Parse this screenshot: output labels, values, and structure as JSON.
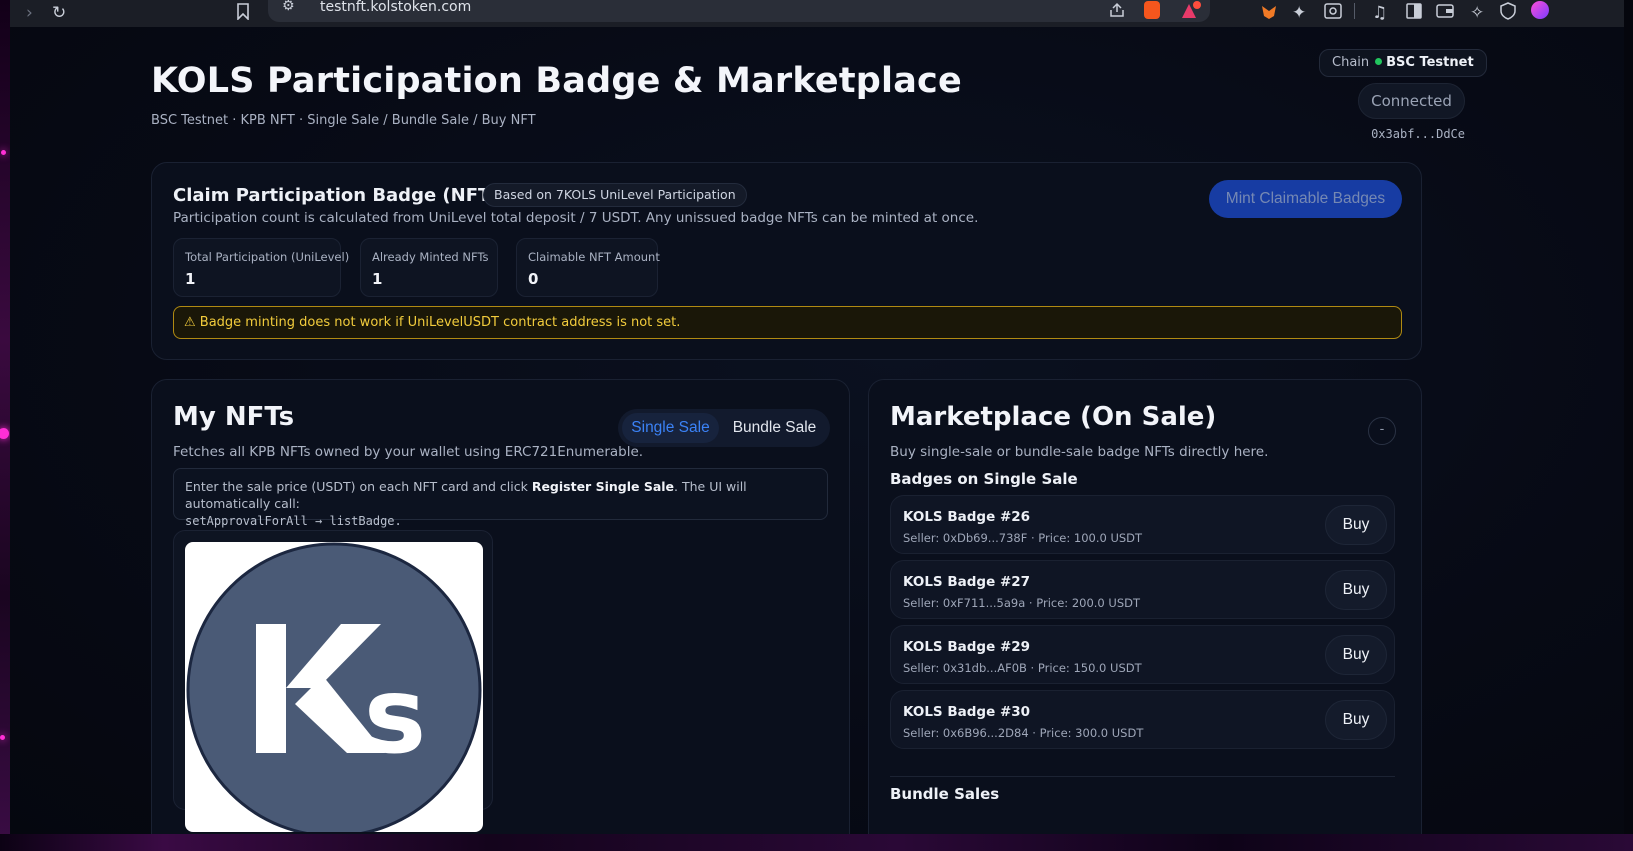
{
  "browser": {
    "url": "testnft.kolstoken.com"
  },
  "header": {
    "title": "KOLS Participation Badge & Marketplace",
    "subtitle": "BSC Testnet · KPB NFT · Single Sale / Bundle Sale / Buy NFT",
    "chain_label": "Chain",
    "chain_value": "BSC Testnet",
    "connected_label": "Connected",
    "wallet_address": "0x3abf...DdCe"
  },
  "claim": {
    "title": "Claim Participation Badge (NFT Mint)",
    "tag": "Based on 7KOLS UniLevel Participation",
    "description": "Participation count is calculated from UniLevel total deposit / 7 USDT. Any unissued badge NFTs can be minted at once.",
    "mint_button": "Mint Claimable Badges",
    "stats": [
      {
        "label": "Total Participation (UniLevel)",
        "value": "1"
      },
      {
        "label": "Already Minted NFTs",
        "value": "1"
      },
      {
        "label": "Claimable NFT Amount",
        "value": "0"
      }
    ],
    "warning": "⚠ Badge minting does not work if UniLevelUSDT contract address is not set."
  },
  "my_nfts": {
    "title": "My NFTs",
    "description": "Fetches all KPB NFTs owned by your wallet using ERC721Enumerable.",
    "toggle_single": "Single Sale",
    "toggle_bundle": "Bundle Sale",
    "info_pre": "Enter the sale price (USDT) on each NFT card and click ",
    "info_bold": "Register Single Sale",
    "info_post": ". The UI will automatically call:",
    "info_code": "setApprovalForAll → listBadge."
  },
  "marketplace": {
    "title": "Marketplace (On Sale)",
    "description": "Buy single-sale or bundle-sale badge NFTs directly here.",
    "collapse_label": "-",
    "single_heading": "Badges on Single Sale",
    "bundle_heading": "Bundle Sales",
    "buy_label": "Buy",
    "listings": [
      {
        "name": "KOLS Badge #26",
        "meta": "Seller: 0xDb69...738F · Price: 100.0 USDT"
      },
      {
        "name": "KOLS Badge #27",
        "meta": "Seller: 0xF711...5a9a · Price: 200.0 USDT"
      },
      {
        "name": "KOLS Badge #29",
        "meta": "Seller: 0x31db...AF0B · Price: 150.0 USDT"
      },
      {
        "name": "KOLS Badge #30",
        "meta": "Seller: 0x6B96...2D84 · Price: 300.0 USDT"
      }
    ]
  },
  "colors": {
    "accent": "#3b82f6",
    "mint_button": "#1d4ed8",
    "warning": "#f2cc3c",
    "online": "#22c55e",
    "logo_circle": "#4a5a76"
  }
}
